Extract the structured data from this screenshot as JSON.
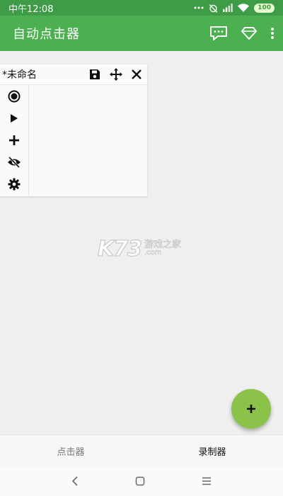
{
  "status_bar": {
    "time": "中午12:08",
    "battery": "100"
  },
  "toolbar": {
    "title": "自动点击器",
    "actions": [
      "message-icon",
      "diamond-icon",
      "more-vert-icon"
    ]
  },
  "panel": {
    "name": "*未命名",
    "header_tools": [
      "save-icon",
      "move-icon",
      "close-icon"
    ],
    "side_tools": [
      "record-icon",
      "play-icon",
      "add-icon",
      "hide-icon",
      "settings-icon"
    ]
  },
  "watermark": {
    "logo": "K73",
    "text": "游戏之家",
    "domain": ".com"
  },
  "fab": {
    "icon": "plus-icon"
  },
  "bottom_nav": {
    "tabs": [
      {
        "label": "点击器",
        "active": false
      },
      {
        "label": "录制器",
        "active": true
      }
    ]
  },
  "colors": {
    "status_bar": "#3f9c46",
    "toolbar": "#4caf50",
    "fab": "#8bc34a",
    "background": "#efefef"
  }
}
